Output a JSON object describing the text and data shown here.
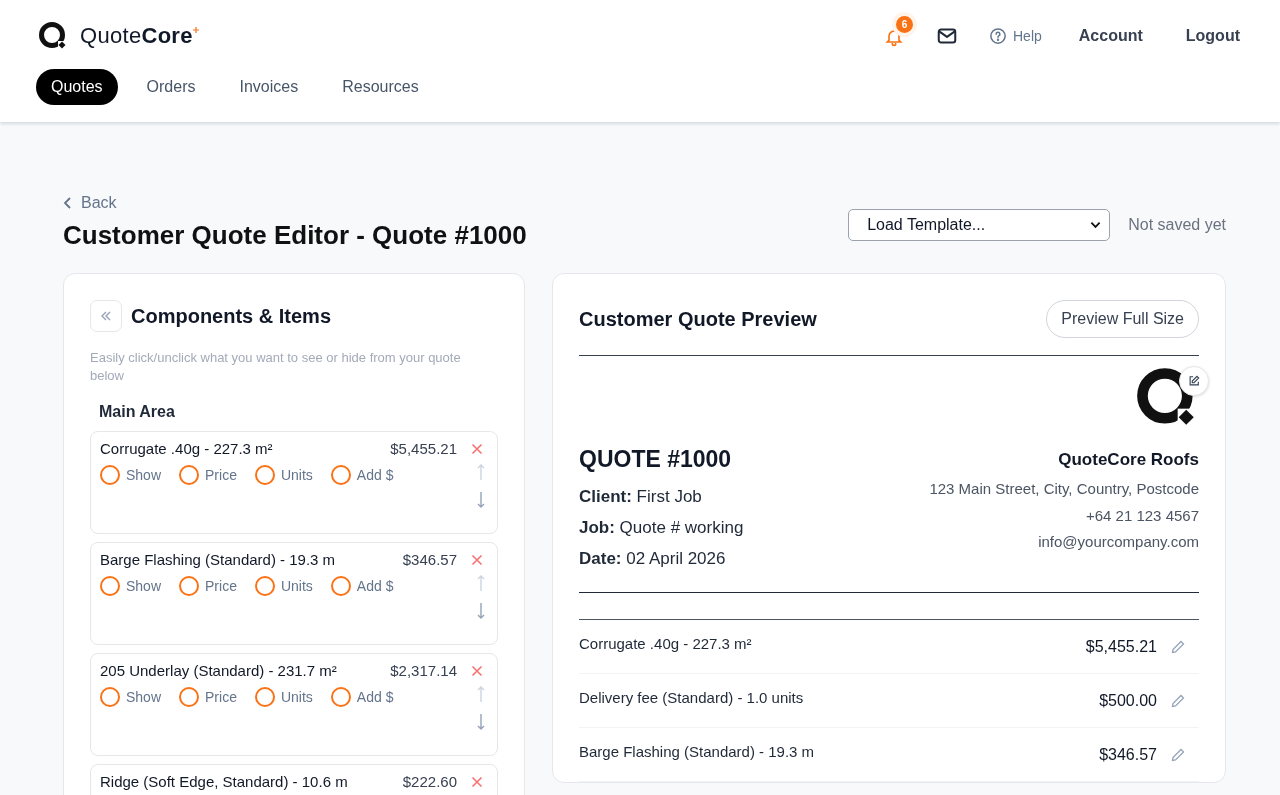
{
  "brand": {
    "name": "Quote**Core**"
  },
  "header": {
    "notifications": "6",
    "help": "Help",
    "account": "Account",
    "logout": "Logout"
  },
  "nav": [
    {
      "label": "Quotes",
      "selected": true
    },
    {
      "label": "Orders",
      "selected": false
    },
    {
      "label": "Invoices",
      "selected": false
    },
    {
      "label": "Resources",
      "selected": false
    }
  ],
  "page": {
    "back": "Back",
    "title": "Customer Quote Editor - Quote #1000",
    "template_select": "Load Template...",
    "save_status": "Not saved yet"
  },
  "components": {
    "title": "Components & Items",
    "hint": "Easily click/unclick what you want to see or hide from your quote below",
    "section": "Main Area",
    "items": [
      {
        "name": "Corrugate .40g - 227.3 m²",
        "price": "$5,455.21",
        "options": [
          {
            "label": "Show",
            "checked": false
          },
          {
            "label": "Price",
            "checked": false
          },
          {
            "label": "Units",
            "checked": false
          },
          {
            "label": "Add $",
            "checked": false
          }
        ]
      },
      {
        "name": "Barge Flashing (Standard) - 19.3 m",
        "price": "$346.57",
        "options": [
          {
            "label": "Show",
            "checked": false
          },
          {
            "label": "Price",
            "checked": false
          },
          {
            "label": "Units",
            "checked": false
          },
          {
            "label": "Add $",
            "checked": false
          }
        ]
      },
      {
        "name": "205 Underlay (Standard) - 231.7 m²",
        "price": "$2,317.14",
        "options": [
          {
            "label": "Show",
            "checked": false
          },
          {
            "label": "Price",
            "checked": false
          },
          {
            "label": "Units",
            "checked": false
          },
          {
            "label": "Add $",
            "checked": false
          }
        ]
      },
      {
        "name": "Ridge (Soft Edge, Standard) - 10.6 m",
        "price": "$222.60"
      }
    ]
  },
  "preview": {
    "title": "Customer Quote Preview",
    "full_size": "Preview Full Size",
    "quote_number": "QUOTE #1000",
    "details": [
      "**Client:** First Job",
      "**Job:** Quote # working",
      "**Date:** 02 April 2026"
    ],
    "company": {
      "name": "QuoteCore Roofs",
      "lines": [
        "123 Main Street, City, Country, Postcode",
        "+64 21 123 4567",
        "info@yourcompany.com"
      ]
    },
    "lines": [
      {
        "name": "Corrugate .40g - 227.3 m²",
        "price": "$5,455.21"
      },
      {
        "name": "Delivery fee (Standard) - 1.0 units",
        "price": "$500.00"
      },
      {
        "name": "Barge Flashing (Standard) - 19.3 m",
        "price": "$346.57"
      }
    ]
  }
}
